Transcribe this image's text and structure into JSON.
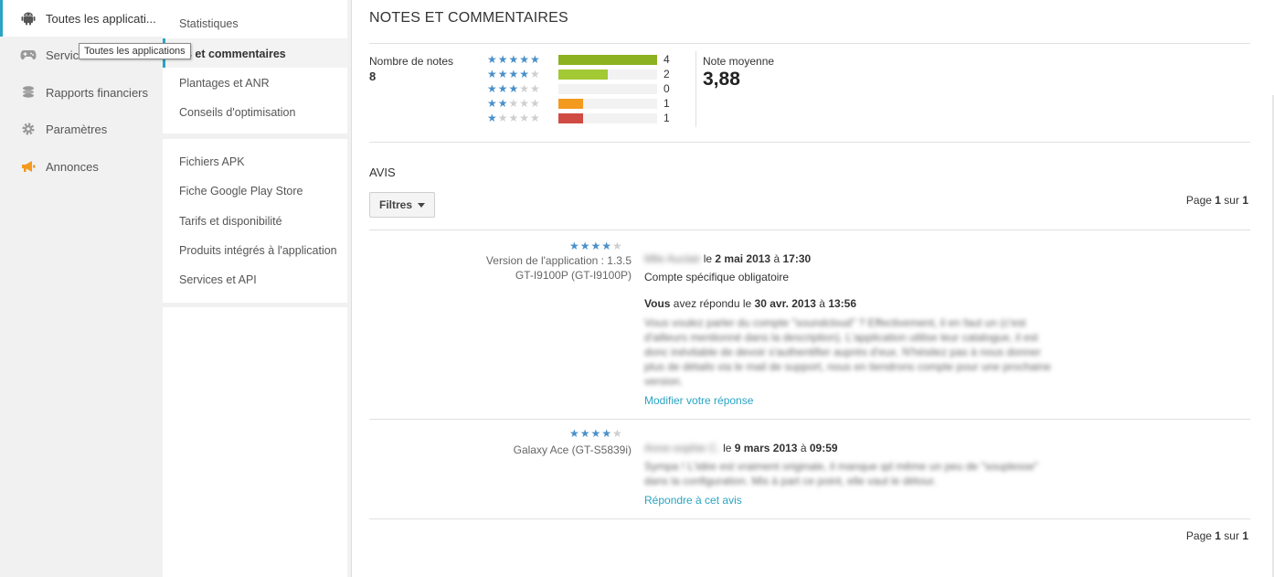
{
  "left_nav": {
    "items": [
      {
        "label": "Toutes les applicati...",
        "icon": "android-icon",
        "active": true
      },
      {
        "label": "Services de jeux",
        "icon": "gamepad-icon",
        "active": false
      },
      {
        "label": "Rapports financiers",
        "icon": "coins-icon",
        "active": false
      },
      {
        "label": "Paramètres",
        "icon": "gear-icon",
        "active": false
      },
      {
        "label": "Annonces",
        "icon": "megaphone-icon",
        "active": false
      }
    ],
    "visible_partial_label": "Servic",
    "tooltip": "Toutes les applications"
  },
  "sub_nav": {
    "group1": [
      {
        "label": "Statistiques"
      },
      {
        "label": "es et commentaires",
        "active": true
      },
      {
        "label": "Plantages et ANR"
      },
      {
        "label": "Conseils d'optimisation"
      }
    ],
    "group2": [
      {
        "label": "Fichiers APK"
      },
      {
        "label": "Fiche Google Play Store"
      },
      {
        "label": "Tarifs et disponibilité"
      },
      {
        "label": "Produits intégrés à l'application"
      },
      {
        "label": "Services et API"
      }
    ]
  },
  "main": {
    "title": "NOTES ET COMMENTAIRES",
    "ratings": {
      "count_label": "Nombre de notes",
      "count": "8",
      "distribution": [
        {
          "stars": 5,
          "count": 4,
          "color": "#8cb121"
        },
        {
          "stars": 4,
          "count": 2,
          "color": "#a3c934"
        },
        {
          "stars": 3,
          "count": 0,
          "color": "#f5c030"
        },
        {
          "stars": 2,
          "count": 1,
          "color": "#f39a1f"
        },
        {
          "stars": 1,
          "count": 1,
          "color": "#cf4b43"
        }
      ],
      "max_count": 4,
      "average_label": "Note moyenne",
      "average": "3,88"
    },
    "reviews_title": "AVIS",
    "filters_label": "Filtres",
    "pager": {
      "prefix": "Page",
      "current": "1",
      "sep": "sur",
      "total": "1"
    },
    "reviews": [
      {
        "rating": 4,
        "version": "Version de l'application : 1.3.5",
        "device": "GT-I9100P (GT-I9100P)",
        "author": "Mlle Auclair",
        "date_prefix": "le",
        "date": "2 mai 2013",
        "time_prefix": "à",
        "time": "17:30",
        "text": "Compte spécifique obligatoire",
        "reply_author": "Vous",
        "reply_prefix": "avez répondu le",
        "reply_date": "30 avr. 2013",
        "reply_time_prefix": "à",
        "reply_time": "13:56",
        "reply_text": "Vous voulez parler du compte \"soundcloud\" ? Effectivement, il en faut un (c'est d'ailleurs mentionné dans la description). L'application utilise leur catalogue, il est donc inévitable de devoir s'authentifier auprès d'eux. N'hésitez pas à nous donner plus de détails via le mail de support, nous en tiendrons compte pour une prochaine version.",
        "action": "Modifier votre réponse"
      },
      {
        "rating": 4,
        "device": "Galaxy Ace (GT-S5839i)",
        "author": "Anne-sophie C.",
        "date_prefix": "le",
        "date": "9 mars 2013",
        "time_prefix": "à",
        "time": "09:59",
        "text": "Sympa ! L'idée est vraiment originale, il manque qd même un peu de \"souplesse\" dans la configuration. Mis à part ce point, elle vaut le détour.",
        "action": "Répondre à cet avis"
      }
    ]
  }
}
